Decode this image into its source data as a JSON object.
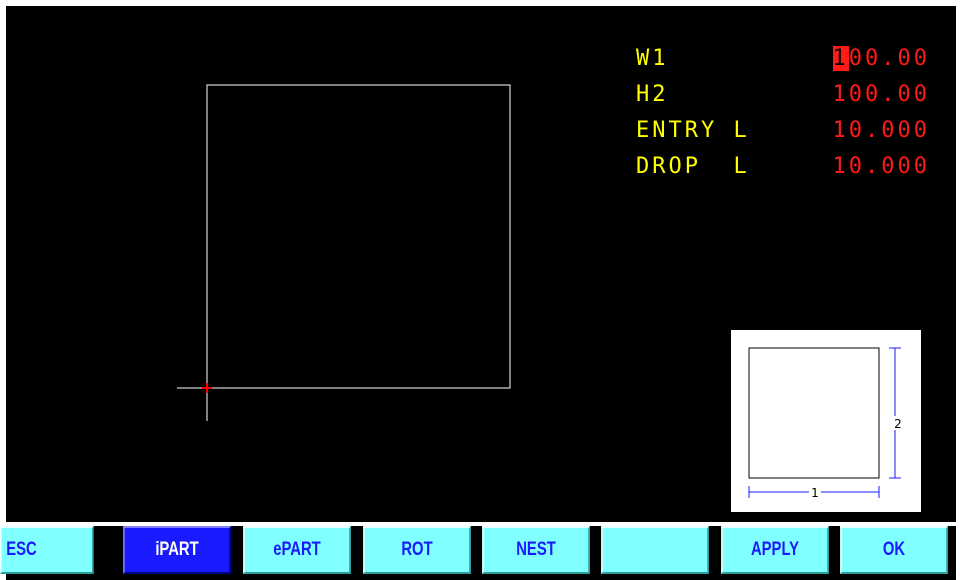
{
  "params": [
    {
      "label": "W1",
      "value": "100.00",
      "cursor_char": "1",
      "value_rest": "00.00"
    },
    {
      "label": "H2",
      "value": "100.00"
    },
    {
      "label": "ENTRY L",
      "value": "10.000"
    },
    {
      "label": "DROP  L",
      "value": "10.000"
    }
  ],
  "preview": {
    "label_1": "1",
    "label_2": "2"
  },
  "toolbar": {
    "esc": "ESC",
    "ipart": "iPART",
    "epart": "ePART",
    "rot": "ROT",
    "nest": "NEST",
    "blank": "",
    "apply": "APPLY",
    "ok": "OK"
  },
  "colors": {
    "background": "#000000",
    "label": "#ffff00",
    "value": "#ff1a1a",
    "shape": "#ffffff",
    "origin_marker": "#ff0000",
    "toolbar_button": "#7fffff",
    "toolbar_active": "#1a1aff",
    "dimension_lines": "#1a1aff"
  },
  "icons": {
    "origin": "origin-crosshair-icon"
  }
}
